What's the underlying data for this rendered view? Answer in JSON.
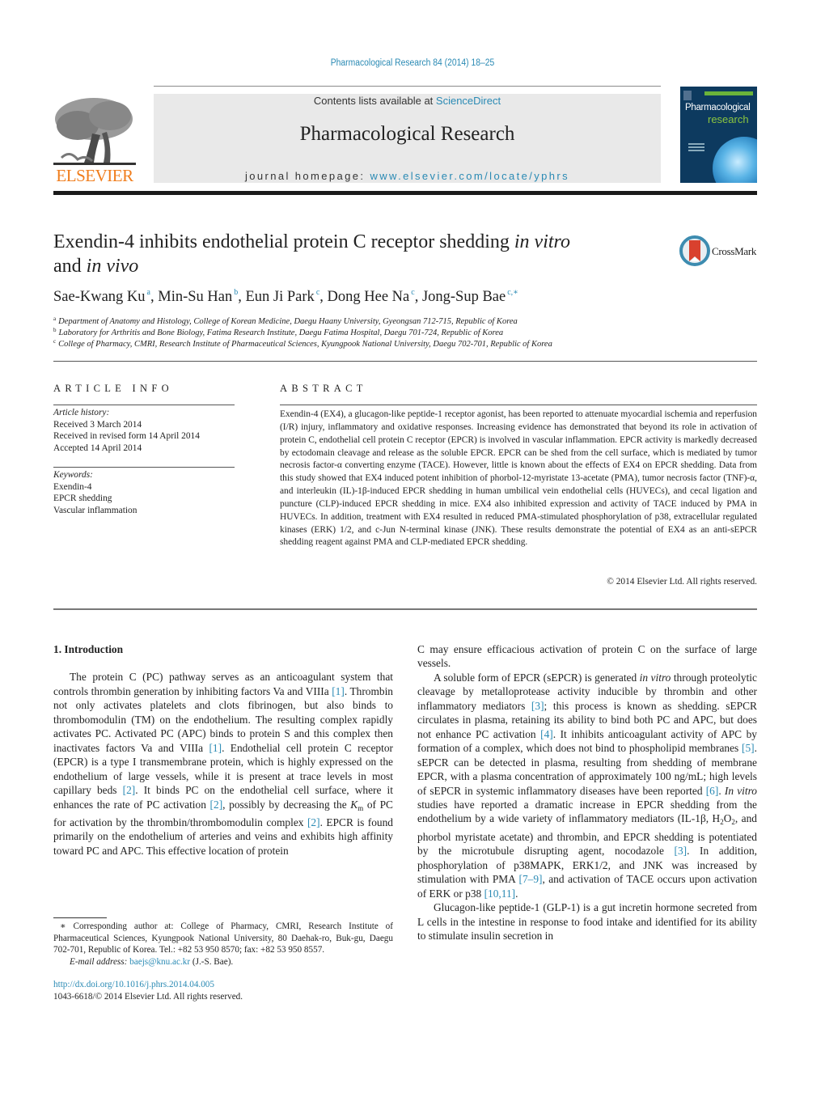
{
  "header": {
    "citation": "Pharmacological Research 84 (2014) 18–25",
    "contents_prefix": "Contents lists available at ",
    "contents_link": "ScienceDirect",
    "journal_title": "Pharmacological Research",
    "homepage_prefix": "journal homepage: ",
    "homepage_link": "www.elsevier.com/locate/yphrs",
    "publisher_logo_text": "ELSEVIER",
    "cover": {
      "line1": "Pharmacological",
      "line2": "research"
    },
    "crossmark_label": "CrossMark"
  },
  "article": {
    "title_part1": "Exendin-4 inhibits endothelial protein C receptor shedding ",
    "title_italic1": "in vitro",
    "title_part2": "and ",
    "title_italic2": "in vivo",
    "authors": [
      {
        "name": "Sae-Kwang Ku",
        "sup": "a"
      },
      {
        "name": "Min-Su Han",
        "sup": "b"
      },
      {
        "name": "Eun Ji Park",
        "sup": "c"
      },
      {
        "name": "Dong Hee Na",
        "sup": "c"
      },
      {
        "name": "Jong-Sup Bae",
        "sup": "c,∗"
      }
    ],
    "affiliations": [
      {
        "mark": "a",
        "text": "Department of Anatomy and Histology, College of Korean Medicine, Daegu Haany University, Gyeongsan 712-715, Republic of Korea"
      },
      {
        "mark": "b",
        "text": "Laboratory for Arthritis and Bone Biology, Fatima Research Institute, Daegu Fatima Hospital, Daegu 701-724, Republic of Korea"
      },
      {
        "mark": "c",
        "text": "College of Pharmacy, CMRI, Research Institute of Pharmaceutical Sciences, Kyungpook National University, Daegu 702-701, Republic of Korea"
      }
    ]
  },
  "article_info": {
    "heading": "ARTICLE INFO",
    "history_label": "Article history:",
    "received": "Received 3 March 2014",
    "revised": "Received in revised form 14 April 2014",
    "accepted": "Accepted 14 April 2014",
    "keywords_label": "Keywords:",
    "keywords": [
      "Exendin-4",
      "EPCR shedding",
      "Vascular inflammation"
    ]
  },
  "abstract": {
    "heading": "ABSTRACT",
    "text": "Exendin-4 (EX4), a glucagon-like peptide-1 receptor agonist, has been reported to attenuate myocardial ischemia and reperfusion (I/R) injury, inflammatory and oxidative responses. Increasing evidence has demonstrated that beyond its role in activation of protein C, endothelial cell protein C receptor (EPCR) is involved in vascular inflammation. EPCR activity is markedly decreased by ectodomain cleavage and release as the soluble EPCR. EPCR can be shed from the cell surface, which is mediated by tumor necrosis factor-α converting enzyme (TACE). However, little is known about the effects of EX4 on EPCR shedding. Data from this study showed that EX4 induced potent inhibition of phorbol-12-myristate 13-acetate (PMA), tumor necrosis factor (TNF)-α, and interleukin (IL)-1β-induced EPCR shedding in human umbilical vein endothelial cells (HUVECs), and cecal ligation and puncture (CLP)-induced EPCR shedding in mice. EX4 also inhibited expression and activity of TACE induced by PMA in HUVECs. In addition, treatment with EX4 resulted in reduced PMA-stimulated phosphorylation of p38, extracellular regulated kinases (ERK) 1/2, and c-Jun N-terminal kinase (JNK). These results demonstrate the potential of EX4 as an anti-sEPCR shedding reagent against PMA and CLP-mediated EPCR shedding.",
    "copyright": "© 2014 Elsevier Ltd. All rights reserved."
  },
  "body": {
    "section_heading": "1.  Introduction",
    "left": {
      "p1_a": "The protein C (PC) pathway serves as an anticoagulant system that controls thrombin generation by inhibiting factors Va and VIIIa ",
      "p1_ref1": "[1]",
      "p1_b": ". Thrombin not only activates platelets and clots fibrinogen, but also binds to thrombomodulin (TM) on the endothelium. The resulting complex rapidly activates PC. Activated PC (APC) binds to protein S and this complex then inactivates factors Va and VIIIa ",
      "p1_ref2": "[1]",
      "p1_c": ". Endothelial cell protein C receptor (EPCR) is a type I transmembrane protein, which is highly expressed on the endothelium of large vessels, while it is present at trace levels in most capillary beds ",
      "p1_ref3": "[2]",
      "p1_d": ". It binds PC on the endothelial cell surface, where it enhances the rate of PC activation ",
      "p1_ref4": "[2]",
      "p1_e": ", possibly by decreasing the ",
      "p1_km": "K",
      "p1_km_sub": "m",
      "p1_f": " of PC for activation by the thrombin/thrombomodulin complex ",
      "p1_ref5": "[2]",
      "p1_g": ". EPCR is found primarily on the endothelium of arteries and veins and exhibits high affinity toward PC and APC. This effective location of protein"
    },
    "right": {
      "p1_cont": "C may ensure efficacious activation of protein C on the surface of large vessels.",
      "p2_a": "A soluble form of EPCR (sEPCR) is generated ",
      "p2_it1": "in vitro",
      "p2_b": " through proteolytic cleavage by metalloprotease activity inducible by thrombin and other inflammatory mediators ",
      "p2_ref1": "[3]",
      "p2_c": "; this process is known as shedding. sEPCR circulates in plasma, retaining its ability to bind both PC and APC, but does not enhance PC activation ",
      "p2_ref2": "[4]",
      "p2_d": ". It inhibits anticoagulant activity of APC by formation of a complex, which does not bind to phospholipid membranes ",
      "p2_ref3": "[5]",
      "p2_e": ". sEPCR can be detected in plasma, resulting from shedding of membrane EPCR, with a plasma concentration of approximately 100 ng/mL; high levels of sEPCR in systemic inflammatory diseases have been reported ",
      "p2_ref4": "[6]",
      "p2_f": ". ",
      "p2_it2": "In vitro",
      "p2_g": " studies have reported a dramatic increase in EPCR shedding from the endothelium by a wide variety of inflammatory mediators (IL-1β, H",
      "p2_sub1": "2",
      "p2_h": "O",
      "p2_sub2": "2",
      "p2_i": ", and phorbol myristate acetate) and thrombin, and EPCR shedding is potentiated by the microtubule disrupting agent, nocodazole ",
      "p2_ref5": "[3]",
      "p2_j": ". In addition, phosphorylation of p38MAPK, ERK1/2, and JNK was increased by stimulation with PMA ",
      "p2_ref6": "[7–9]",
      "p2_k": ", and activation of TACE occurs upon activation of ERK or p38 ",
      "p2_ref7": "[10,11]",
      "p2_l": ".",
      "p3": "Glucagon-like peptide-1 (GLP-1) is a gut incretin hormone secreted from L cells in the intestine in response to food intake and identified for its ability to stimulate insulin secretion in"
    }
  },
  "footnote": {
    "star_text": "∗  Corresponding author at: College of Pharmacy, CMRI, Research Institute of Pharmaceutical Sciences, Kyungpook National University, 80 Daehak-ro, Buk-gu, Daegu 702-701, Republic of Korea. Tel.: +82 53 950 8570; fax: +82 53 950 8557.",
    "email_label": "E-mail address: ",
    "email": "baejs@knu.ac.kr",
    "email_suffix": " (J.-S. Bae).",
    "doi": "http://dx.doi.org/10.1016/j.phrs.2014.04.005",
    "issn": "1043-6618/© 2014 Elsevier Ltd. All rights reserved."
  }
}
